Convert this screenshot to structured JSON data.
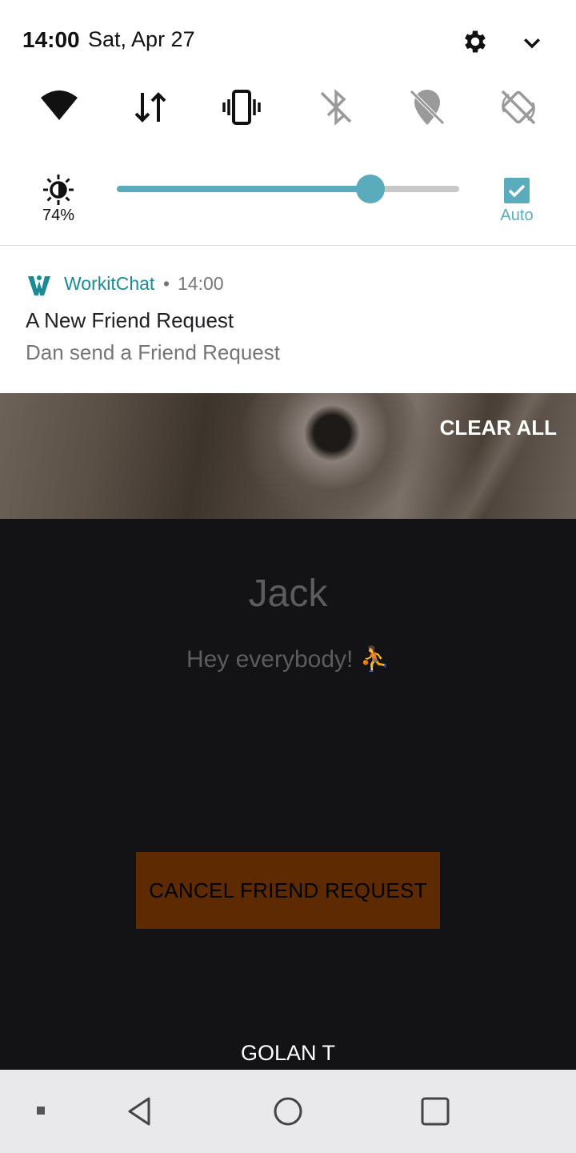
{
  "status_bar": {
    "time": "14:00",
    "date": "Sat, Apr 27"
  },
  "quick_settings": {
    "tiles": [
      {
        "icon": "wifi-icon",
        "enabled": true
      },
      {
        "icon": "mobile-data-icon",
        "enabled": true
      },
      {
        "icon": "vibrate-icon",
        "enabled": true
      },
      {
        "icon": "bluetooth-off-icon",
        "enabled": false
      },
      {
        "icon": "location-off-icon",
        "enabled": false
      },
      {
        "icon": "auto-rotate-off-icon",
        "enabled": false
      }
    ],
    "brightness": {
      "value_label": "74%",
      "level": 0.74,
      "auto_label": "Auto",
      "auto_checked": true
    },
    "accent_color": "#5aabbc"
  },
  "notification": {
    "app_name": "WorkitChat",
    "separator": "•",
    "time": "14:00",
    "title": "A New Friend Request",
    "body": "Dan send a Friend Request"
  },
  "clear_all_label": "CLEAR ALL",
  "profile": {
    "name": "Jack",
    "status": "Hey everybody! ⛹",
    "cancel_button_label": "CANCEL FRIEND REQUEST",
    "cancel_button_color": "#5e2a02",
    "footer_name": "GOLAN T"
  }
}
